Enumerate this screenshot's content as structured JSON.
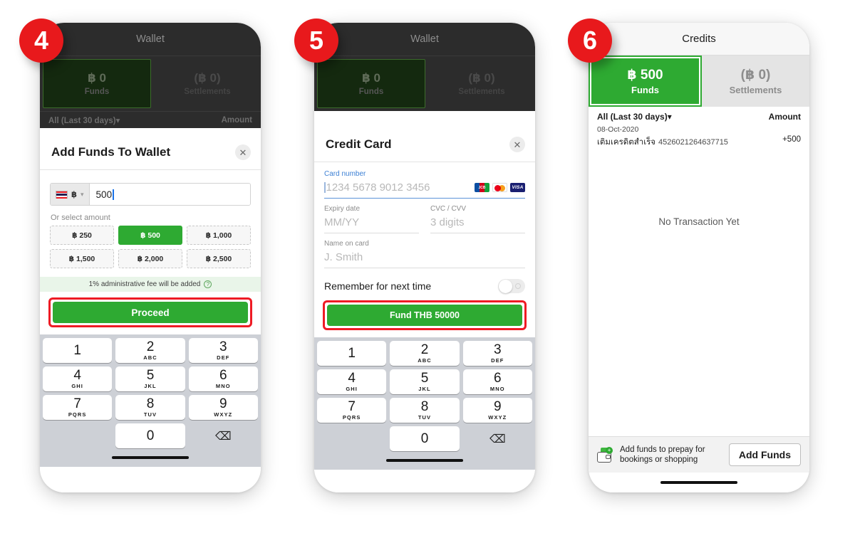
{
  "steps": [
    {
      "number": "4"
    },
    {
      "number": "5"
    },
    {
      "number": "6"
    }
  ],
  "colors": {
    "accent_green": "#2eaa32",
    "highlight_red": "#ee1b24",
    "dark_bg": "#2c2c2c",
    "link_blue": "#3b7fd4"
  },
  "panel4": {
    "background": {
      "nav_title": "Wallet",
      "back_icon": "back-chevron-icon",
      "funds_amount": "฿ 0",
      "funds_label": "Funds",
      "settlements_amount": "(฿ 0)",
      "settlements_label": "Settlements",
      "filter_label": "All (Last 30 days)▾",
      "amount_header": "Amount"
    },
    "sheet": {
      "title": "Add Funds To Wallet",
      "close_icon": "close-icon",
      "currency_flag": "thailand-flag-icon",
      "currency_symbol": "฿",
      "currency_chevron": "chevron-down-icon",
      "amount_value": "500",
      "or_select_label": "Or select amount",
      "chips": [
        {
          "label": "฿ 250",
          "selected": false
        },
        {
          "label": "฿ 500",
          "selected": true
        },
        {
          "label": "฿ 1,000",
          "selected": false
        },
        {
          "label": "฿ 1,500",
          "selected": false
        },
        {
          "label": "฿ 2,000",
          "selected": false
        },
        {
          "label": "฿ 2,500",
          "selected": false
        }
      ],
      "fee_note": "1% administrative fee will be added",
      "fee_icon": "question-mark-icon",
      "cta_label": "Proceed"
    }
  },
  "panel5": {
    "background": {
      "nav_title": "Wallet",
      "back_icon": "back-chevron-icon",
      "funds_amount": "฿ 0",
      "funds_label": "Funds",
      "settlements_amount": "(฿ 0)",
      "settlements_label": "Settlements"
    },
    "sheet": {
      "title": "Credit Card",
      "close_icon": "close-icon",
      "card_number_label": "Card number",
      "card_number_placeholder": "1234 5678 9012 3456",
      "brands": [
        "JCB",
        "Mastercard",
        "VISA"
      ],
      "expiry_label": "Expiry date",
      "expiry_placeholder": "MM/YY",
      "cvc_label": "CVC / CVV",
      "cvc_placeholder": "3 digits",
      "name_label": "Name on card",
      "name_placeholder": "J. Smith",
      "remember_label": "Remember for next time",
      "remember_state": "off",
      "cta_label": "Fund THB 50000"
    }
  },
  "panel6": {
    "nav_title": "Credits",
    "back_icon": "back-chevron-icon",
    "funds_amount": "฿ 500",
    "funds_label": "Funds",
    "settlements_amount": "(฿ 0)",
    "settlements_label": "Settlements",
    "filter_label": "All (Last 30 days)▾",
    "amount_header": "Amount",
    "transaction": {
      "date": "08-Oct-2020",
      "description": "เติมเครดิตสำเร็จ",
      "reference": "4526021264637715",
      "amount": "+500"
    },
    "empty_text": "No Transaction Yet",
    "addbar": {
      "icon": "wallet-plus-icon",
      "text_line1": "Add funds to prepay for",
      "text_line2": "bookings or shopping",
      "button_label": "Add Funds"
    }
  },
  "keypad": {
    "keys": [
      {
        "digit": "1",
        "letters": ""
      },
      {
        "digit": "2",
        "letters": "ABC"
      },
      {
        "digit": "3",
        "letters": "DEF"
      },
      {
        "digit": "4",
        "letters": "GHI"
      },
      {
        "digit": "5",
        "letters": "JKL"
      },
      {
        "digit": "6",
        "letters": "MNO"
      },
      {
        "digit": "7",
        "letters": "PQRS"
      },
      {
        "digit": "8",
        "letters": "TUV"
      },
      {
        "digit": "9",
        "letters": "WXYZ"
      },
      {
        "digit": "0",
        "letters": ""
      }
    ],
    "delete_icon": "backspace-icon"
  }
}
